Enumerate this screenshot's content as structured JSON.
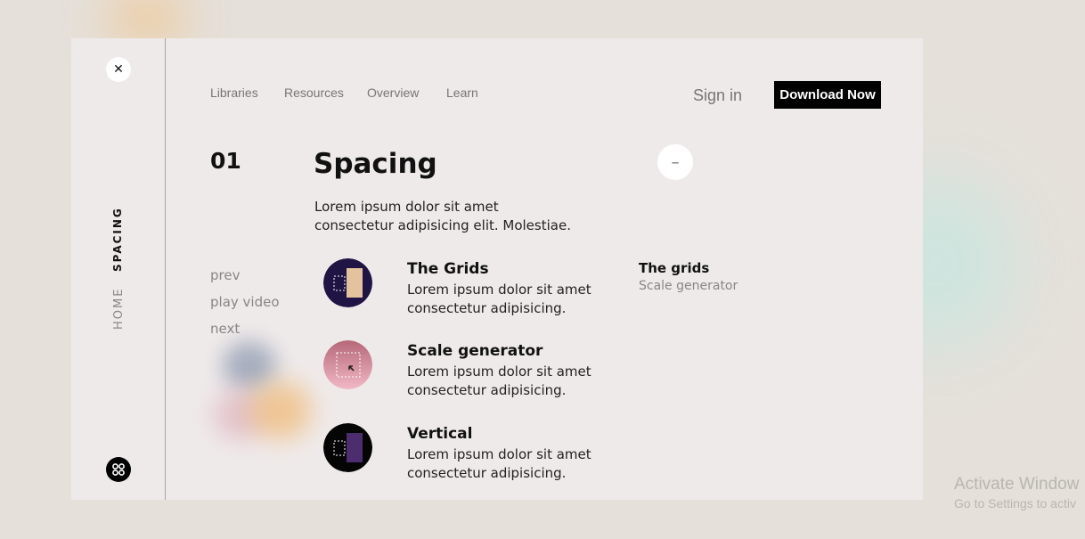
{
  "colors": {
    "background": "#e5e0da",
    "card": "#efeaea",
    "accent_black": "#000000",
    "muted_text": "#7a7575"
  },
  "sidebar": {
    "close_icon": "close-icon",
    "vertical_nav": {
      "active": "SPACING",
      "home": "HOME"
    },
    "logo_icon": "cmd-logo-icon"
  },
  "topnav": {
    "links": [
      "Libraries",
      "Resources",
      "Overview",
      "Learn"
    ],
    "sign_in": "Sign in",
    "download": "Download Now"
  },
  "section": {
    "number": "01",
    "title": "Spacing",
    "description": "Lorem ipsum dolor sit amet consectetur adipisicing elit. Molestiae.",
    "collapse_icon": "minus-icon"
  },
  "side_links": [
    "prev",
    "play video",
    "next"
  ],
  "features": [
    {
      "title": "The Grids",
      "description": "Lorem ipsum dolor sit amet consectetur adipisicing.",
      "icon": "grid-icon",
      "icon_colors": {
        "bg": "#1f1444",
        "accent": "#e3c39e"
      }
    },
    {
      "title": "Scale generator",
      "description": "Lorem ipsum dolor sit amet consectetur adipisicing.",
      "icon": "scale-icon",
      "icon_colors": {
        "bg_top": "#b56878",
        "bg_bottom": "#f2b8c6"
      }
    },
    {
      "title": "Vertical",
      "description": "Lorem ipsum dolor sit amet consectetur adipisicing.",
      "icon": "vertical-icon",
      "icon_colors": {
        "bg": "#050505",
        "accent": "#4c2d6e"
      }
    }
  ],
  "side_info": {
    "title": "The grids",
    "subtitle": "Scale generator"
  },
  "watermark": {
    "line1": "Activate Window",
    "line2": "Go to Settings to activ"
  }
}
